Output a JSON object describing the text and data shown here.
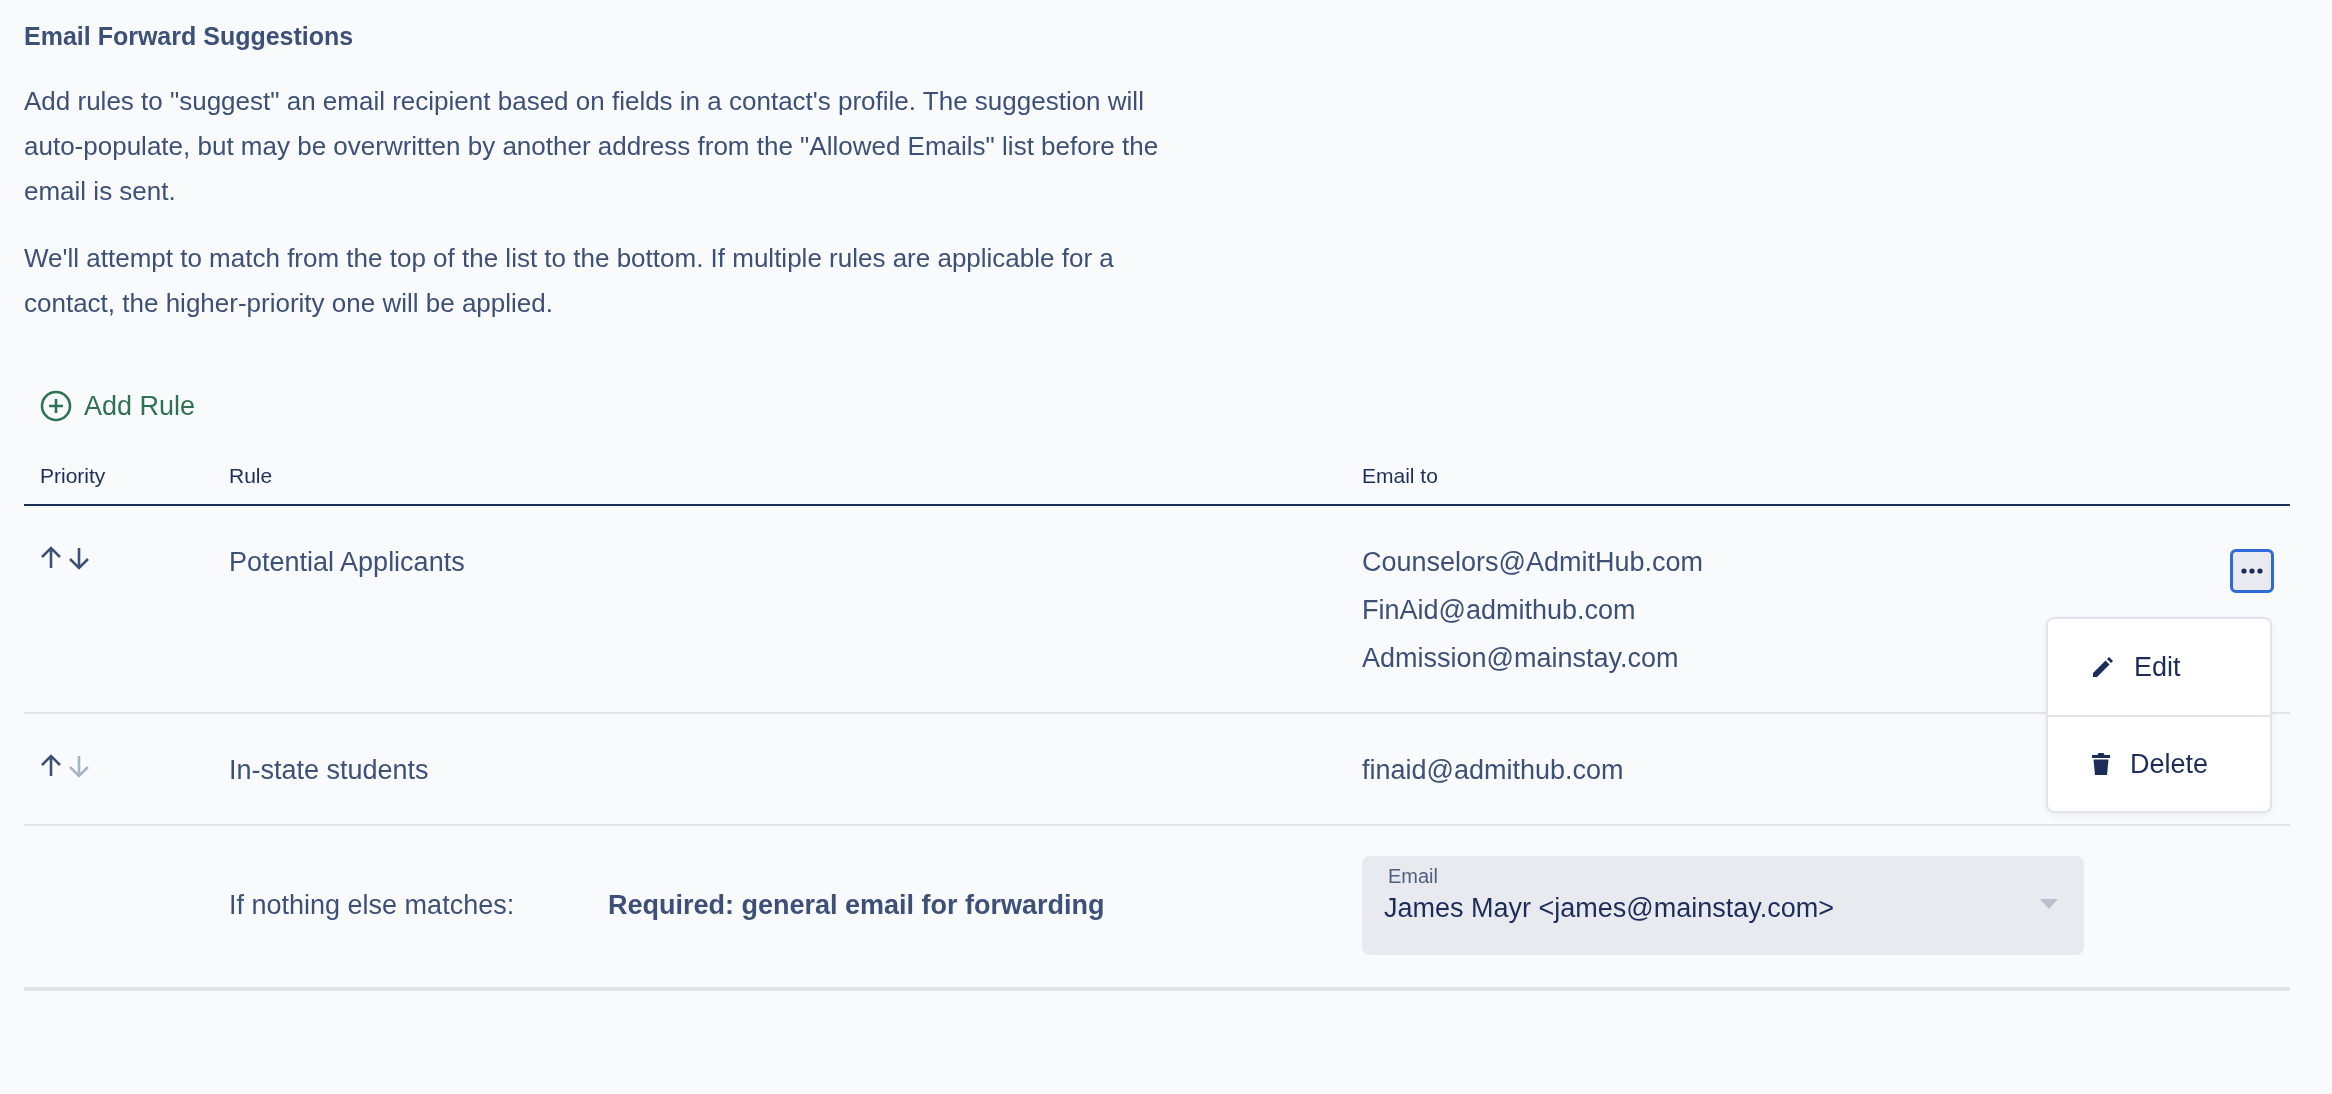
{
  "title": "Email Forward Suggestions",
  "description": [
    "Add rules to \"suggest\" an email recipient based on fields in a contact's profile. The suggestion will auto-populate, but may be overwritten by another address from the \"Allowed Emails\" list before the email is sent.",
    "We'll attempt to match from the top of the list to the bottom. If multiple rules are applicable for a contact, the higher-priority one will be applied."
  ],
  "add_button": {
    "label": "Add Rule"
  },
  "table": {
    "columns": [
      "Priority",
      "Rule",
      "Email to"
    ],
    "rows": [
      {
        "move_up_disabled": false,
        "move_down_disabled": false,
        "rule": "Potential Applicants",
        "emails": [
          "Counselors@AdmitHub.com",
          "FinAid@admithub.com",
          "Admission@mainstay.com"
        ],
        "menu_open": true
      },
      {
        "move_up_disabled": false,
        "move_down_disabled": true,
        "rule": "In-state students",
        "emails": [
          "finaid@admithub.com"
        ],
        "menu_open": false
      }
    ]
  },
  "menu": {
    "items": [
      {
        "kind": "edit",
        "label": "Edit"
      },
      {
        "kind": "delete",
        "label": "Delete"
      }
    ]
  },
  "fallback": {
    "label": "If nothing else matches:",
    "requirement": "Required: general email for forwarding",
    "field": {
      "label": "Email",
      "value": "James Mayr <james@mainstay.com>"
    }
  }
}
